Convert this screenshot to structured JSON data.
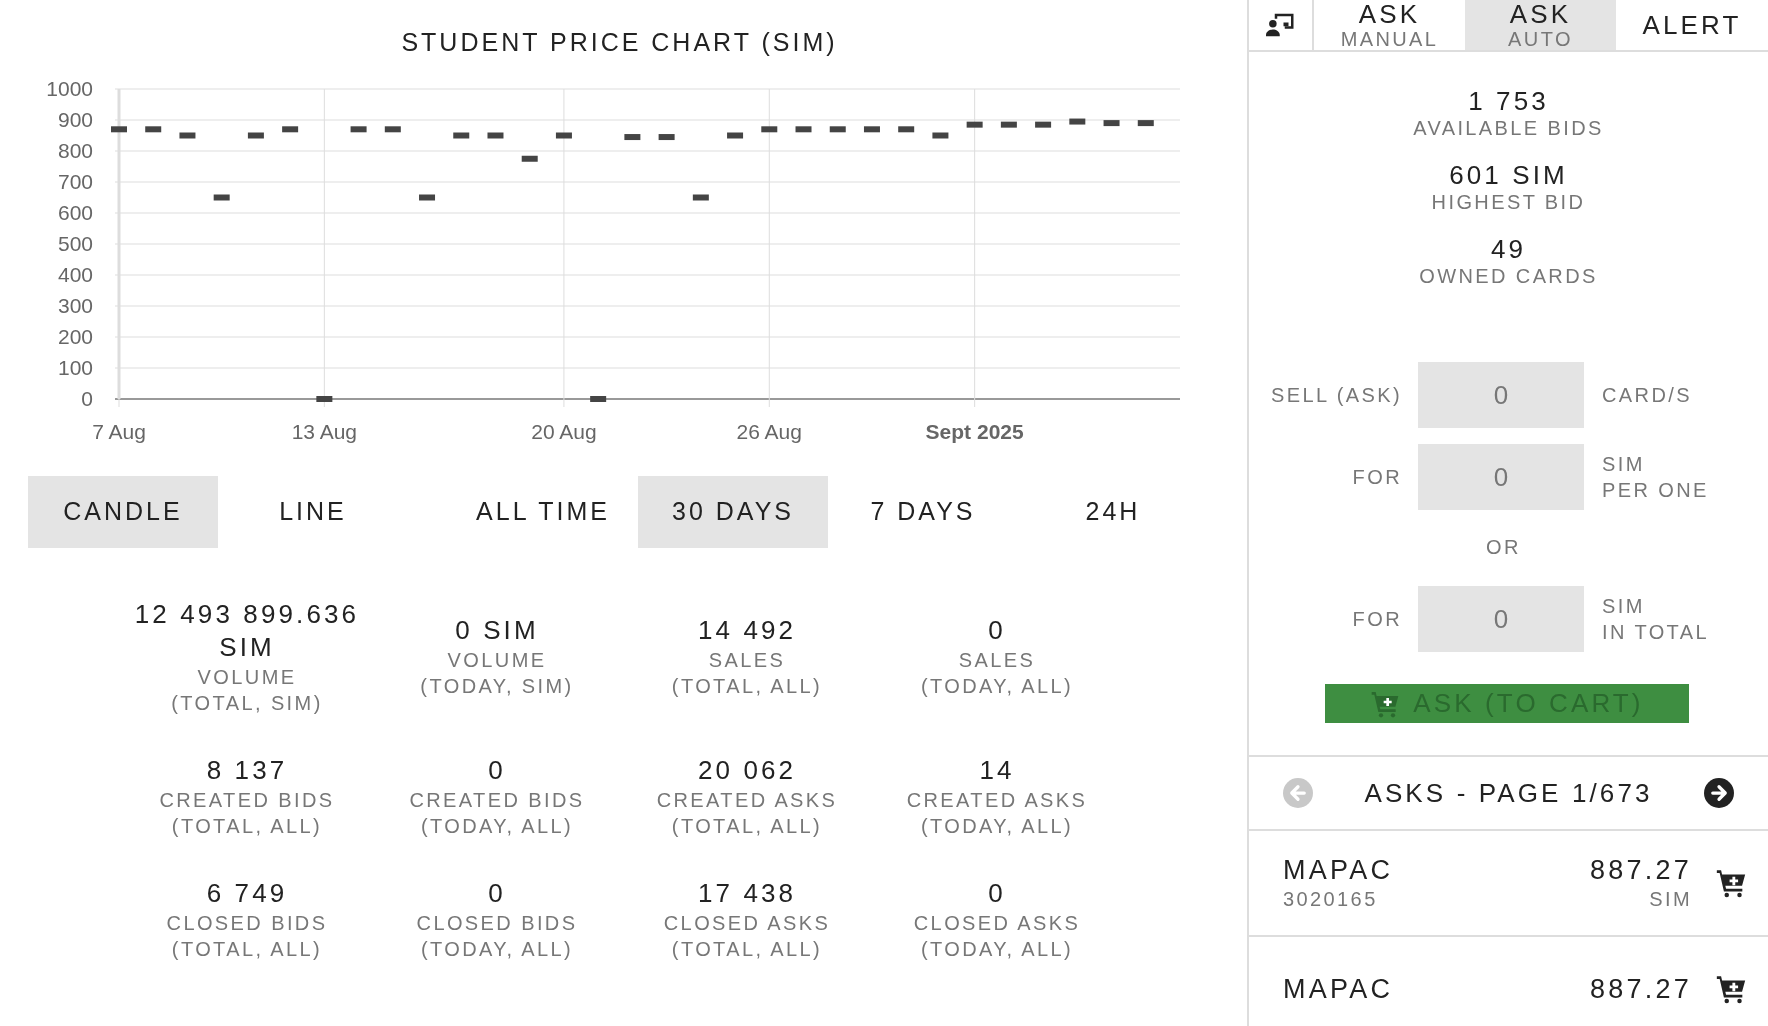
{
  "chart": {
    "title": "STUDENT PRICE CHART (SIM)",
    "chart_data": {
      "type": "scatter",
      "categories": [
        "7 Aug",
        null,
        null,
        null,
        null,
        null,
        "13 Aug",
        null,
        null,
        null,
        null,
        null,
        null,
        "20 Aug",
        null,
        null,
        null,
        null,
        null,
        "26 Aug",
        null,
        null,
        null,
        null,
        null,
        "Sept 2025",
        null,
        null,
        null,
        null,
        null
      ],
      "grid": true,
      "series": [
        {
          "color": "#444444",
          "values": [
            870,
            870,
            850,
            650,
            850,
            870,
            0,
            870,
            870,
            650,
            850,
            850,
            775,
            850,
            0,
            845,
            845,
            650,
            850,
            870,
            870,
            870,
            870,
            870,
            850,
            885,
            885,
            885,
            895,
            890,
            890
          ]
        }
      ],
      "ylim": [
        0,
        1000
      ],
      "yticks": [
        0,
        100,
        200,
        300,
        400,
        500,
        600,
        700,
        800,
        900,
        1000
      ]
    }
  },
  "chart_types": [
    {
      "label": "CANDLE",
      "selected": true
    },
    {
      "label": "LINE",
      "selected": false
    }
  ],
  "ranges": [
    {
      "label": "ALL TIME",
      "selected": false
    },
    {
      "label": "30 DAYS",
      "selected": true
    },
    {
      "label": "7 DAYS",
      "selected": false
    },
    {
      "label": "24H",
      "selected": false
    }
  ],
  "stats": [
    {
      "value": "12 493 899.636 SIM",
      "label": "VOLUME",
      "sub": "(TOTAL, SIM)"
    },
    {
      "value": "0 SIM",
      "label": "VOLUME",
      "sub": "(TODAY, SIM)"
    },
    {
      "value": "14 492",
      "label": "SALES",
      "sub": "(TOTAL, ALL)"
    },
    {
      "value": "0",
      "label": "SALES",
      "sub": "(TODAY, ALL)"
    },
    {
      "value": "8 137",
      "label": "CREATED BIDS",
      "sub": "(TOTAL, ALL)"
    },
    {
      "value": "0",
      "label": "CREATED BIDS",
      "sub": "(TODAY, ALL)"
    },
    {
      "value": "20 062",
      "label": "CREATED ASKS",
      "sub": "(TOTAL, ALL)"
    },
    {
      "value": "14",
      "label": "CREATED ASKS",
      "sub": "(TODAY, ALL)"
    },
    {
      "value": "6 749",
      "label": "CLOSED BIDS",
      "sub": "(TOTAL, ALL)"
    },
    {
      "value": "0",
      "label": "CLOSED BIDS",
      "sub": "(TODAY, ALL)"
    },
    {
      "value": "17 438",
      "label": "CLOSED ASKS",
      "sub": "(TOTAL, ALL)"
    },
    {
      "value": "0",
      "label": "CLOSED ASKS",
      "sub": "(TODAY, ALL)"
    }
  ],
  "panel": {
    "tabs": [
      {
        "kind": "icon",
        "selected": false
      },
      {
        "kind": "text",
        "label": "ASK",
        "sub": "MANUAL",
        "selected": false
      },
      {
        "kind": "text",
        "label": "ASK",
        "sub": "AUTO",
        "selected": true
      },
      {
        "kind": "text",
        "label": "ALERT",
        "selected": false
      }
    ],
    "summary": [
      {
        "value": "1 753",
        "label": "AVAILABLE BIDS"
      },
      {
        "value": "601 SIM",
        "label": "HIGHEST BID"
      },
      {
        "value": "49",
        "label": "OWNED CARDS"
      }
    ],
    "form": [
      {
        "kind": "field",
        "label": "SELL (ASK)",
        "placeholder": "0",
        "unit": "CARD/S"
      },
      {
        "kind": "field",
        "label": "FOR",
        "placeholder": "0",
        "unit": "SIM",
        "unit_sub": "PER ONE"
      },
      {
        "kind": "divider",
        "label": "OR"
      },
      {
        "kind": "field",
        "label": "FOR",
        "placeholder": "0",
        "unit": "SIM",
        "unit_sub": "IN TOTAL"
      }
    ],
    "submit": {
      "label": "ASK (TO CART)",
      "disabled": true
    },
    "pager": {
      "title": "ASKS - PAGE 1/673",
      "prev_disabled": true,
      "next_disabled": false
    },
    "asks": [
      {
        "name": "MAPAC",
        "id": "3020165",
        "price": "887.27",
        "unit": "SIM"
      },
      {
        "name": "MAPAC",
        "price": "887.27"
      }
    ]
  }
}
